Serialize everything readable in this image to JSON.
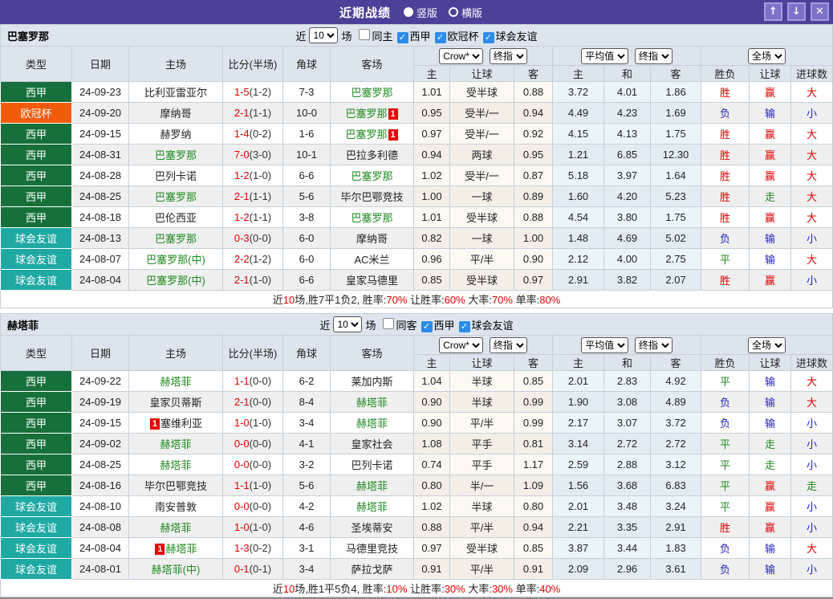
{
  "titlebar": {
    "title": "近期战绩",
    "radio_vertical": "竖版",
    "radio_horizontal": "横版",
    "selected_radio": "竖版",
    "up_icon": "↑",
    "down_icon": "↓",
    "close_icon": "✕"
  },
  "controls": {
    "near": "近",
    "recent_value": "10",
    "games_suffix": "场",
    "odds_company": "Crow*",
    "final": "终指",
    "average": "平均值",
    "scope": "全场"
  },
  "header": {
    "main": [
      "类型",
      "日期",
      "主场",
      "比分(半场)",
      "角球",
      "客场"
    ],
    "sub": [
      "主",
      "让球",
      "客",
      "主",
      "和",
      "客",
      "胜负",
      "让球",
      "进球数"
    ]
  },
  "colors": {
    "titlebar": "#4c4199",
    "liga_green": "#17703c",
    "ucl_orange": "#f25b0c",
    "friendly_teal": "#1fa9a4",
    "team_green": "#1e8a1e",
    "score_red": "#e60000",
    "win_red": "#e60000",
    "lose_blue": "#2222cc",
    "draw_green": "#1e8a1e",
    "checkbox_blue": "#2b8ceb"
  },
  "sections": [
    {
      "team": "巴塞罗那",
      "filter": {
        "checkboxes": [
          {
            "label": "同主",
            "checked": false
          },
          {
            "label": "西甲",
            "checked": true
          },
          {
            "label": "欧冠杯",
            "checked": true
          },
          {
            "label": "球会友谊",
            "checked": true
          }
        ]
      },
      "rows": [
        {
          "type": "西甲",
          "k": "liga",
          "date": "24-09-23",
          "home": {
            "n": "比利亚雷亚尔"
          },
          "ft": "1-5",
          "ht": "(1-2)",
          "corner": "7-3",
          "away": {
            "n": "巴塞罗那",
            "g": 1
          },
          "odds": [
            "1.01",
            "受半球",
            "0.88"
          ],
          "avg": [
            "3.72",
            "4.01",
            "1.86"
          ],
          "res": [
            [
              "胜",
              "w"
            ],
            [
              "赢",
              "w"
            ],
            [
              "大",
              "w"
            ]
          ]
        },
        {
          "type": "欧冠杯",
          "k": "ucl",
          "date": "24-09-20",
          "home": {
            "n": "摩纳哥"
          },
          "ft": "2-1",
          "ht": "(1-1)",
          "corner": "10-0",
          "away": {
            "n": "巴塞罗那",
            "g": 1,
            "badge": "1",
            "bpos": "after"
          },
          "odds": [
            "0.95",
            "受半/一",
            "0.94"
          ],
          "avg": [
            "4.49",
            "4.23",
            "1.69"
          ],
          "res": [
            [
              "负",
              "l"
            ],
            [
              "输",
              "l"
            ],
            [
              "小",
              "l"
            ]
          ]
        },
        {
          "type": "西甲",
          "k": "liga",
          "date": "24-09-15",
          "home": {
            "n": "赫罗纳"
          },
          "ft": "1-4",
          "ht": "(0-2)",
          "corner": "1-6",
          "away": {
            "n": "巴塞罗那",
            "g": 1,
            "badge": "1",
            "bpos": "after"
          },
          "odds": [
            "0.97",
            "受半/一",
            "0.92"
          ],
          "avg": [
            "4.15",
            "4.13",
            "1.75"
          ],
          "res": [
            [
              "胜",
              "w"
            ],
            [
              "赢",
              "w"
            ],
            [
              "大",
              "w"
            ]
          ]
        },
        {
          "type": "西甲",
          "k": "liga",
          "date": "24-08-31",
          "home": {
            "n": "巴塞罗那",
            "g": 1
          },
          "ft": "7-0",
          "ht": "(3-0)",
          "corner": "10-1",
          "away": {
            "n": "巴拉多利德"
          },
          "odds": [
            "0.94",
            "两球",
            "0.95"
          ],
          "avg": [
            "1.21",
            "6.85",
            "12.30"
          ],
          "res": [
            [
              "胜",
              "w"
            ],
            [
              "赢",
              "w"
            ],
            [
              "大",
              "w"
            ]
          ]
        },
        {
          "type": "西甲",
          "k": "liga",
          "date": "24-08-28",
          "home": {
            "n": "巴列卡诺"
          },
          "ft": "1-2",
          "ht": "(1-0)",
          "corner": "6-6",
          "away": {
            "n": "巴塞罗那",
            "g": 1
          },
          "odds": [
            "1.02",
            "受半/一",
            "0.87"
          ],
          "avg": [
            "5.18",
            "3.97",
            "1.64"
          ],
          "res": [
            [
              "胜",
              "w"
            ],
            [
              "赢",
              "w"
            ],
            [
              "大",
              "w"
            ]
          ]
        },
        {
          "type": "西甲",
          "k": "liga",
          "date": "24-08-25",
          "home": {
            "n": "巴塞罗那",
            "g": 1
          },
          "ft": "2-1",
          "ht": "(1-1)",
          "corner": "5-6",
          "away": {
            "n": "毕尔巴鄂竞技"
          },
          "odds": [
            "1.00",
            "一球",
            "0.89"
          ],
          "avg": [
            "1.60",
            "4.20",
            "5.23"
          ],
          "res": [
            [
              "胜",
              "w"
            ],
            [
              "走",
              "d"
            ],
            [
              "大",
              "w"
            ]
          ]
        },
        {
          "type": "西甲",
          "k": "liga",
          "date": "24-08-18",
          "home": {
            "n": "巴伦西亚"
          },
          "ft": "1-2",
          "ht": "(1-1)",
          "corner": "3-8",
          "away": {
            "n": "巴塞罗那",
            "g": 1
          },
          "odds": [
            "1.01",
            "受半球",
            "0.88"
          ],
          "avg": [
            "4.54",
            "3.80",
            "1.75"
          ],
          "res": [
            [
              "胜",
              "w"
            ],
            [
              "赢",
              "w"
            ],
            [
              "大",
              "w"
            ]
          ]
        },
        {
          "type": "球会友谊",
          "k": "friendly",
          "date": "24-08-13",
          "home": {
            "n": "巴塞罗那",
            "g": 1
          },
          "ft": "0-3",
          "ht": "(0-0)",
          "corner": "6-0",
          "away": {
            "n": "摩纳哥"
          },
          "odds": [
            "0.82",
            "一球",
            "1.00"
          ],
          "avg": [
            "1.48",
            "4.69",
            "5.02"
          ],
          "res": [
            [
              "负",
              "l"
            ],
            [
              "输",
              "l"
            ],
            [
              "小",
              "l"
            ]
          ]
        },
        {
          "type": "球会友谊",
          "k": "friendly",
          "date": "24-08-07",
          "home": {
            "n": "巴塞罗那(中)",
            "g": 1
          },
          "ft": "2-2",
          "ht": "(1-2)",
          "corner": "6-0",
          "away": {
            "n": "AC米兰"
          },
          "odds": [
            "0.96",
            "平/半",
            "0.90"
          ],
          "avg": [
            "2.12",
            "4.00",
            "2.75"
          ],
          "res": [
            [
              "平",
              "d"
            ],
            [
              "输",
              "l"
            ],
            [
              "大",
              "w"
            ]
          ]
        },
        {
          "type": "球会友谊",
          "k": "friendly",
          "date": "24-08-04",
          "home": {
            "n": "巴塞罗那(中)",
            "g": 1
          },
          "ft": "2-1",
          "ht": "(1-0)",
          "corner": "6-6",
          "away": {
            "n": "皇家马德里"
          },
          "odds": [
            "0.85",
            "受半球",
            "0.97"
          ],
          "avg": [
            "2.91",
            "3.82",
            "2.07"
          ],
          "res": [
            [
              "胜",
              "w"
            ],
            [
              "赢",
              "w"
            ],
            [
              "小",
              "l"
            ]
          ]
        }
      ],
      "summary": [
        [
          "近",
          0
        ],
        [
          "10",
          1
        ],
        [
          "场,胜7平1负2, 胜率:",
          0
        ],
        [
          "70%",
          1
        ],
        [
          " 让胜率:",
          0
        ],
        [
          "60%",
          1
        ],
        [
          " 大率:",
          0
        ],
        [
          "70%",
          1
        ],
        [
          " 单率:",
          0
        ],
        [
          "80%",
          1
        ]
      ]
    },
    {
      "team": "赫塔菲",
      "filter": {
        "checkboxes": [
          {
            "label": "同客",
            "checked": false
          },
          {
            "label": "西甲",
            "checked": true
          },
          {
            "label": "球会友谊",
            "checked": true
          }
        ]
      },
      "rows": [
        {
          "type": "西甲",
          "k": "liga",
          "date": "24-09-22",
          "home": {
            "n": "赫塔菲",
            "g": 1
          },
          "ft": "1-1",
          "ht": "(0-0)",
          "corner": "6-2",
          "away": {
            "n": "莱加内斯"
          },
          "odds": [
            "1.04",
            "半球",
            "0.85"
          ],
          "avg": [
            "2.01",
            "2.83",
            "4.92"
          ],
          "res": [
            [
              "平",
              "d"
            ],
            [
              "输",
              "l"
            ],
            [
              "大",
              "w"
            ]
          ]
        },
        {
          "type": "西甲",
          "k": "liga",
          "date": "24-09-19",
          "home": {
            "n": "皇家贝蒂斯"
          },
          "ft": "2-1",
          "ht": "(0-0)",
          "corner": "8-4",
          "away": {
            "n": "赫塔菲",
            "g": 1
          },
          "odds": [
            "0.90",
            "半球",
            "0.99"
          ],
          "avg": [
            "1.90",
            "3.08",
            "4.89"
          ],
          "res": [
            [
              "负",
              "l"
            ],
            [
              "输",
              "l"
            ],
            [
              "大",
              "w"
            ]
          ]
        },
        {
          "type": "西甲",
          "k": "liga",
          "date": "24-09-15",
          "home": {
            "n": "塞维利亚",
            "badge": "1",
            "bpos": "before"
          },
          "ft": "1-0",
          "ht": "(1-0)",
          "corner": "3-4",
          "away": {
            "n": "赫塔菲",
            "g": 1
          },
          "odds": [
            "0.90",
            "平/半",
            "0.99"
          ],
          "avg": [
            "2.17",
            "3.07",
            "3.72"
          ],
          "res": [
            [
              "负",
              "l"
            ],
            [
              "输",
              "l"
            ],
            [
              "小",
              "l"
            ]
          ]
        },
        {
          "type": "西甲",
          "k": "liga",
          "date": "24-09-02",
          "home": {
            "n": "赫塔菲",
            "g": 1
          },
          "ft": "0-0",
          "ht": "(0-0)",
          "corner": "4-1",
          "away": {
            "n": "皇家社会"
          },
          "odds": [
            "1.08",
            "平手",
            "0.81"
          ],
          "avg": [
            "3.14",
            "2.72",
            "2.72"
          ],
          "res": [
            [
              "平",
              "d"
            ],
            [
              "走",
              "d"
            ],
            [
              "小",
              "l"
            ]
          ]
        },
        {
          "type": "西甲",
          "k": "liga",
          "date": "24-08-25",
          "home": {
            "n": "赫塔菲",
            "g": 1
          },
          "ft": "0-0",
          "ht": "(0-0)",
          "corner": "3-2",
          "away": {
            "n": "巴列卡诺"
          },
          "odds": [
            "0.74",
            "平手",
            "1.17"
          ],
          "avg": [
            "2.59",
            "2.88",
            "3.12"
          ],
          "res": [
            [
              "平",
              "d"
            ],
            [
              "走",
              "d"
            ],
            [
              "小",
              "l"
            ]
          ]
        },
        {
          "type": "西甲",
          "k": "liga",
          "date": "24-08-16",
          "home": {
            "n": "毕尔巴鄂竞技"
          },
          "ft": "1-1",
          "ht": "(1-0)",
          "corner": "5-6",
          "away": {
            "n": "赫塔菲",
            "g": 1
          },
          "odds": [
            "0.80",
            "半/一",
            "1.09"
          ],
          "avg": [
            "1.56",
            "3.68",
            "6.83"
          ],
          "res": [
            [
              "平",
              "d"
            ],
            [
              "赢",
              "w"
            ],
            [
              "走",
              "d"
            ]
          ]
        },
        {
          "type": "球会友谊",
          "k": "friendly",
          "date": "24-08-10",
          "home": {
            "n": "南安普敦"
          },
          "ft": "0-0",
          "ht": "(0-0)",
          "corner": "4-2",
          "away": {
            "n": "赫塔菲",
            "g": 1
          },
          "odds": [
            "1.02",
            "半球",
            "0.80"
          ],
          "avg": [
            "2.01",
            "3.48",
            "3.24"
          ],
          "res": [
            [
              "平",
              "d"
            ],
            [
              "赢",
              "w"
            ],
            [
              "小",
              "l"
            ]
          ]
        },
        {
          "type": "球会友谊",
          "k": "friendly",
          "date": "24-08-08",
          "home": {
            "n": "赫塔菲",
            "g": 1
          },
          "ft": "1-0",
          "ht": "(1-0)",
          "corner": "4-6",
          "away": {
            "n": "圣埃蒂安"
          },
          "odds": [
            "0.88",
            "平/半",
            "0.94"
          ],
          "avg": [
            "2.21",
            "3.35",
            "2.91"
          ],
          "res": [
            [
              "胜",
              "w"
            ],
            [
              "赢",
              "w"
            ],
            [
              "小",
              "l"
            ]
          ]
        },
        {
          "type": "球会友谊",
          "k": "friendly",
          "date": "24-08-04",
          "home": {
            "n": "赫塔菲",
            "g": 1,
            "badge": "1",
            "bpos": "before"
          },
          "ft": "1-3",
          "ht": "(0-2)",
          "corner": "3-1",
          "away": {
            "n": "马德里竞技"
          },
          "odds": [
            "0.97",
            "受半球",
            "0.85"
          ],
          "avg": [
            "3.87",
            "3.44",
            "1.83"
          ],
          "res": [
            [
              "负",
              "l"
            ],
            [
              "输",
              "l"
            ],
            [
              "大",
              "w"
            ]
          ]
        },
        {
          "type": "球会友谊",
          "k": "friendly",
          "date": "24-08-01",
          "home": {
            "n": "赫塔菲(中)",
            "g": 1
          },
          "ft": "0-1",
          "ht": "(0-1)",
          "corner": "3-4",
          "away": {
            "n": "萨拉戈萨"
          },
          "odds": [
            "0.91",
            "平/半",
            "0.91"
          ],
          "avg": [
            "2.09",
            "2.96",
            "3.61"
          ],
          "res": [
            [
              "负",
              "l"
            ],
            [
              "输",
              "l"
            ],
            [
              "小",
              "l"
            ]
          ]
        }
      ],
      "summary": [
        [
          "近",
          0
        ],
        [
          "10",
          1
        ],
        [
          "场,胜1平5负4, 胜率:",
          0
        ],
        [
          "10%",
          1
        ],
        [
          " 让胜率:",
          0
        ],
        [
          "30%",
          1
        ],
        [
          " 大率:",
          0
        ],
        [
          "30%",
          1
        ],
        [
          " 单率:",
          0
        ],
        [
          "40%",
          1
        ]
      ]
    }
  ]
}
